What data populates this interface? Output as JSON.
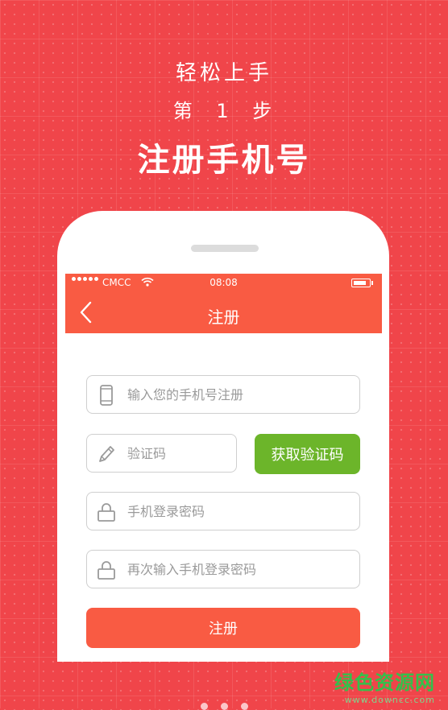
{
  "header": {
    "subtitle": "轻松上手",
    "step": "第 1 步",
    "title": "注册手机号"
  },
  "status_bar": {
    "carrier": "CMCC",
    "time": "08:08"
  },
  "nav": {
    "title": "注册",
    "back_icon": "chevron-left-icon"
  },
  "form": {
    "phone_placeholder": "输入您的手机号注册",
    "code_placeholder": "验证码",
    "get_code_label": "获取验证码",
    "password_placeholder": "手机登录密码",
    "confirm_password_placeholder": "再次输入手机登录密码",
    "submit_label": "注册"
  },
  "watermark": {
    "main": "绿色资源网",
    "sub": "www.downcc.com"
  },
  "colors": {
    "background": "#f0454a",
    "app_bar": "#f95b43",
    "get_code_button": "#6cb52a",
    "submit_button": "#f95b43"
  }
}
